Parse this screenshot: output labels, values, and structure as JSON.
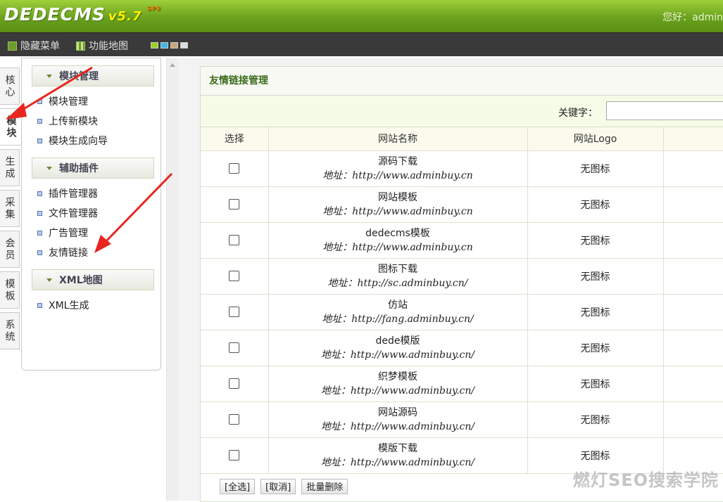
{
  "header": {
    "logo_text": "DEDECMS",
    "version": "v5.7",
    "version_sub": "SP2",
    "greeting": "您好：admin",
    "colors": {
      "accent": "#7cb82f",
      "toolbar": "#3a3a3a",
      "title_text": "#3b6b1d"
    }
  },
  "toolbar": {
    "hide_menu_label": "隐藏菜单",
    "site_map_label": "功能地图",
    "skin_colors": [
      "#9bd11f",
      "#3fb5e8",
      "#c9a77c",
      "#dddddd"
    ]
  },
  "side_tabs": [
    {
      "label": "核心"
    },
    {
      "label": "模块"
    },
    {
      "label": "生成"
    },
    {
      "label": "采集"
    },
    {
      "label": "会员"
    },
    {
      "label": "模板"
    },
    {
      "label": "系统"
    }
  ],
  "menu": {
    "groups": [
      {
        "title": "模块管理",
        "items": [
          "模块管理",
          "上传新模块",
          "模块生成向导"
        ]
      },
      {
        "title": "辅助插件",
        "items": [
          "插件管理器",
          "文件管理器",
          "广告管理",
          "友情链接"
        ]
      },
      {
        "title": "XML地图",
        "items": [
          "XML生成"
        ]
      }
    ]
  },
  "main": {
    "title": "友情链接管理",
    "keyword_label": "关键字：",
    "keyword_value": "",
    "columns": [
      "选择",
      "网站名称",
      "网站Logo",
      ""
    ],
    "rows": [
      {
        "name": "源码下载",
        "url": "地址：http://www.adminbuy.cn",
        "logo": "无图标"
      },
      {
        "name": "网站模板",
        "url": "地址：http://www.adminbuy.cn",
        "logo": "无图标"
      },
      {
        "name": "dedecms模板",
        "url": "地址：http://www.adminbuy.cn",
        "logo": "无图标"
      },
      {
        "name": "图标下载",
        "url": "地址：http://sc.adminbuy.cn/",
        "logo": "无图标"
      },
      {
        "name": "仿站",
        "url": "地址：http://fang.adminbuy.cn/",
        "logo": "无图标"
      },
      {
        "name": "dede模版",
        "url": "地址：http://www.adminbuy.cn/",
        "logo": "无图标"
      },
      {
        "name": "织梦模板",
        "url": "地址：http://www.adminbuy.cn/",
        "logo": "无图标"
      },
      {
        "name": "网站源码",
        "url": "地址：http://www.adminbuy.cn/",
        "logo": "无图标"
      },
      {
        "name": "模版下载",
        "url": "地址：http://www.adminbuy.cn/",
        "logo": "无图标"
      }
    ],
    "actions": {
      "select_all": "[全选]",
      "cancel": "[取消]",
      "batch_delete": "批量删除"
    }
  },
  "watermark": "燃灯SEO搜索学院"
}
